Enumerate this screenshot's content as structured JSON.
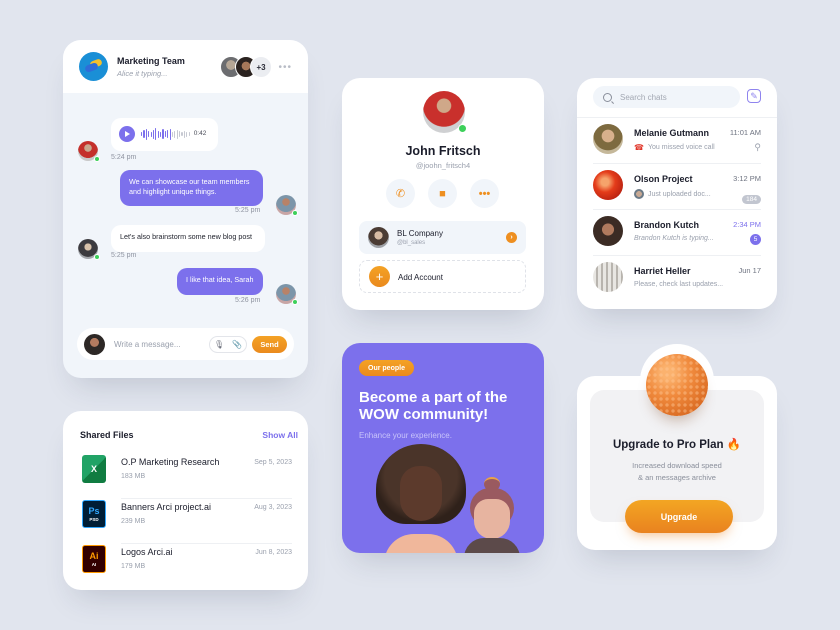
{
  "chat": {
    "team_name": "Marketing Team",
    "status": "Alice it typing...",
    "extra_members": "+3",
    "messages": [
      {
        "type": "voice",
        "direction": "in",
        "duration": "0:42",
        "time": "5:24 pm"
      },
      {
        "type": "text",
        "direction": "out",
        "text": "We can showcase our team members and highlight unique things.",
        "time": "5:25 pm"
      },
      {
        "type": "text",
        "direction": "in",
        "text": "Let's also brainstorm some new blog post",
        "time": "5:25 pm"
      },
      {
        "type": "text",
        "direction": "out",
        "text": "I like that idea, Sarah",
        "time": "5:26 pm"
      }
    ],
    "composer": {
      "placeholder": "Write a message...",
      "send_label": "Send"
    }
  },
  "files": {
    "title": "Shared Files",
    "show_all": "Show All",
    "items": [
      {
        "icon": "excel-icon",
        "badge": "X",
        "name": "O.P Marketing Research",
        "size": "183 MB",
        "date": "Sep 5, 2023"
      },
      {
        "icon": "photoshop-icon",
        "badge": "Ps",
        "sub": "PSD",
        "name": "Banners Arci project.ai",
        "size": "239 MB",
        "date": "Aug 3, 2023"
      },
      {
        "icon": "illustrator-icon",
        "badge": "Ai",
        "sub": "AI",
        "name": "Logos Arci.ai",
        "size": "179 MB",
        "date": "Jun 8, 2023"
      }
    ]
  },
  "profile": {
    "name": "John Fritsch",
    "handle": "@joohn_fritsch4",
    "actions": [
      "phone-icon",
      "video-icon",
      "more-icon"
    ],
    "account": {
      "name": "BL Company",
      "handle": "@bl_sales"
    },
    "add_account": "Add Account"
  },
  "chatlist": {
    "search_placeholder": "Search chats",
    "items": [
      {
        "name": "Melanie Gutmann",
        "preview": "You missed voice call",
        "time": "11:01 AM",
        "indicator": "pin"
      },
      {
        "name": "Olson Project",
        "preview": "Just uploaded doc...",
        "time": "3:12 PM",
        "badge": "184"
      },
      {
        "name": "Brandon Kutch",
        "preview": "Brandon Kutch is typing...",
        "time": "2:34 PM",
        "badge": "5"
      },
      {
        "name": "Harriet Heller",
        "preview": "Please, check last updates...",
        "time": "Jun 17"
      }
    ]
  },
  "promo": {
    "tag": "Our people",
    "title": "Become a part of the WOW community!",
    "subtitle": "Enhance your experience."
  },
  "upgrade": {
    "title": "Upgrade to Pro Plan 🔥",
    "desc_line1": "Increased download speed",
    "desc_line2": "& an messages archive",
    "button": "Upgrade"
  },
  "colors": {
    "accent": "#7c70ec",
    "orange": "#ee8f20",
    "online": "#3dd05a",
    "background": "#e1e5ee"
  }
}
